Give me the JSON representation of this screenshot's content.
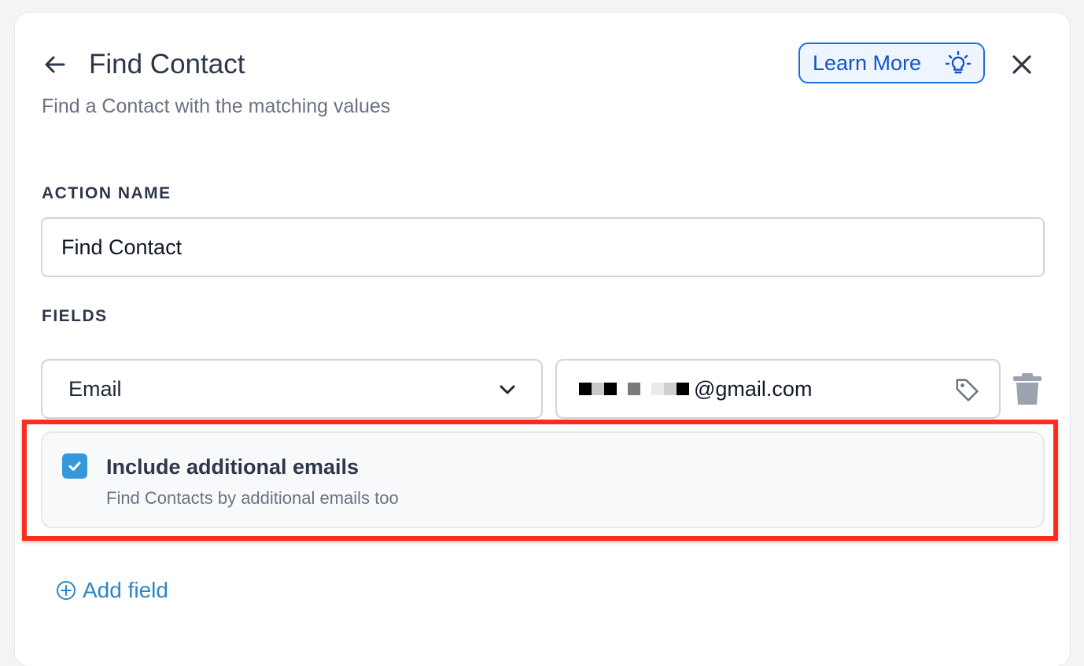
{
  "header": {
    "title": "Find Contact",
    "subtitle": "Find a Contact with the matching values",
    "learn_more_label": "Learn More"
  },
  "action_name": {
    "label": "ACTION NAME",
    "value": "Find Contact"
  },
  "fields": {
    "label": "FIELDS",
    "rows": [
      {
        "field_select_value": "Email",
        "value_suffix": "@gmail.com"
      }
    ]
  },
  "additional_emails_option": {
    "checked": true,
    "title": "Include additional emails",
    "description": "Find Contacts by additional emails too"
  },
  "add_field_label": "Add field",
  "icons": {
    "back": "arrow-left-icon",
    "learn_more": "lightbulb-icon",
    "close": "close-icon",
    "select": "chevron-down-icon",
    "tag": "tag-icon",
    "delete": "trash-icon",
    "checkbox": "checkmark-icon",
    "add": "plus-circle-icon"
  },
  "colors": {
    "accent_blue": "#1d6fe0",
    "checkbox_blue": "#3498db",
    "link_blue": "#2b86c5",
    "highlight_red": "#fa2d1e",
    "text_dark": "#2d3748",
    "text_muted": "#6b7280"
  }
}
